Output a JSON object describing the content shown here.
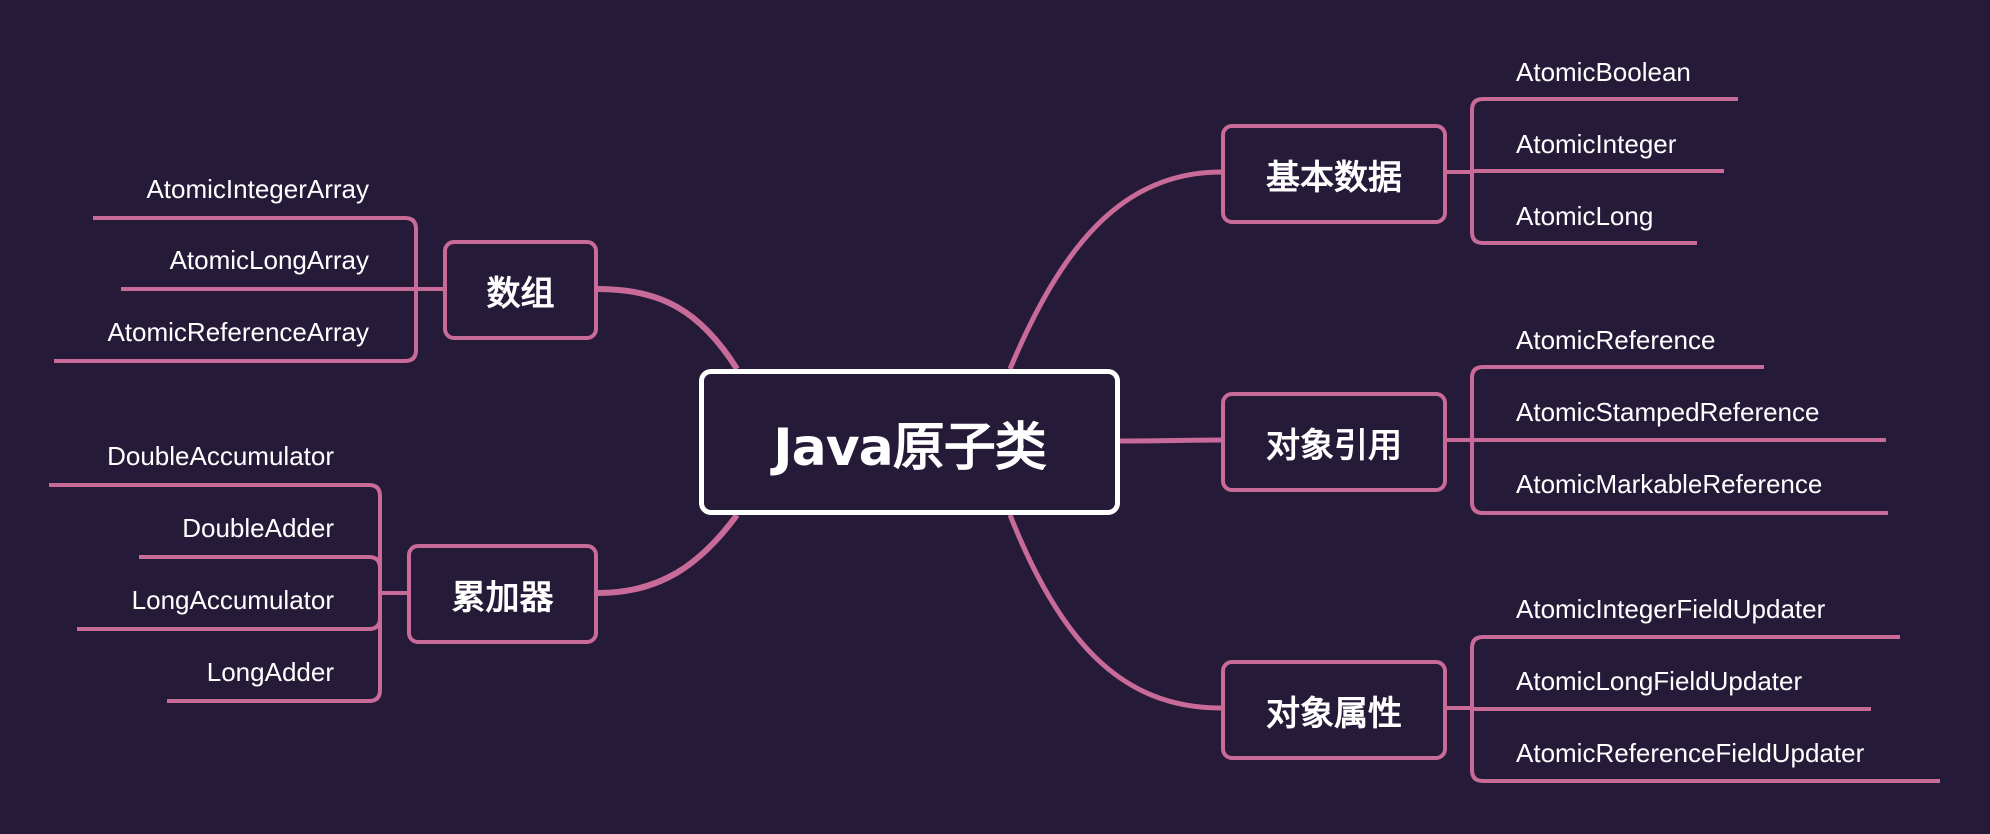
{
  "root": {
    "label": "Java原子类"
  },
  "branches": [
    {
      "label": "基本数据",
      "items": [
        "AtomicBoolean",
        "AtomicInteger",
        "AtomicLong"
      ]
    },
    {
      "label": "对象引用",
      "items": [
        "AtomicReference",
        "AtomicStampedReference",
        "AtomicMarkableReference"
      ]
    },
    {
      "label": "对象属性",
      "items": [
        "AtomicIntegerFieldUpdater",
        "AtomicLongFieldUpdater",
        "AtomicReferenceFieldUpdater"
      ]
    },
    {
      "label": "数组",
      "items": [
        "AtomicIntegerArray",
        "AtomicLongArray",
        "AtomicReferenceArray"
      ]
    },
    {
      "label": "累加器",
      "items": [
        "DoubleAccumulator",
        "DoubleAdder",
        "LongAccumulator",
        "LongAdder"
      ]
    }
  ],
  "colors": {
    "background": "#261a39",
    "accent": "#c96b98",
    "text": "#ffffff"
  }
}
